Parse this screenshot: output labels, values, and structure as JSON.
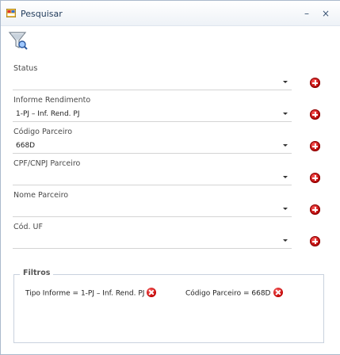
{
  "window": {
    "title": "Pesquisar",
    "minimize_label": "–",
    "close_label": "×"
  },
  "toolbar": {
    "filter_icon": "funnel-search-icon"
  },
  "fields": [
    {
      "label": "Status",
      "value": ""
    },
    {
      "label": "Informe Rendimento",
      "value": "1-PJ – Inf. Rend. PJ"
    },
    {
      "label": "Código Parceiro",
      "value": "668D"
    },
    {
      "label": "CPF/CNPJ Parceiro",
      "value": ""
    },
    {
      "label": "Nome Parceiro",
      "value": ""
    },
    {
      "label": "Cód. UF",
      "value": ""
    }
  ],
  "filters": {
    "title": "Filtros",
    "chips": [
      {
        "text": "Tipo Informe = 1-PJ – Inf. Rend. PJ"
      },
      {
        "text": "Código Parceiro = 668D"
      }
    ]
  },
  "colors": {
    "accent_red": "#c00000",
    "title_text": "#1f3a5a",
    "frame_border": "#aab9cc"
  }
}
